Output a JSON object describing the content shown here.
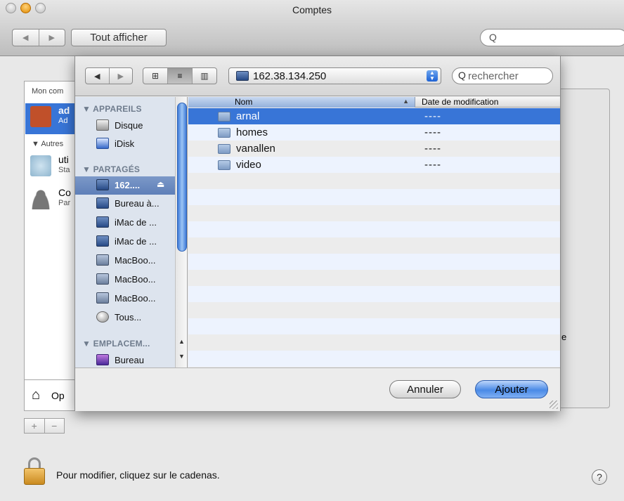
{
  "window": {
    "title": "Comptes",
    "show_all_label": "Tout afficher",
    "search_glyph": "Q"
  },
  "background": {
    "section_my_account": "Mon com",
    "user1_name": "ad",
    "user1_sub": "Ad",
    "section_others": "▼ Autres",
    "user2_name": "uti",
    "user2_sub": "Sta",
    "user3_name": "Co",
    "user3_sub": "Par",
    "options_label": "Op",
    "e_fragment": "e"
  },
  "footer": {
    "lock_text": "Pour modifier, cliquez sur le cadenas.",
    "help_label": "?"
  },
  "sheet": {
    "path_value": "162.38.134.250",
    "search_placeholder": "rechercher",
    "search_glyph": "Q",
    "sidebar": {
      "devices_header": "▼ APPAREILS",
      "devices": [
        {
          "label": "Disque",
          "icon": "disk-icon"
        },
        {
          "label": "iDisk",
          "icon": "idisk-icon"
        }
      ],
      "shared_header": "▼ PARTAGÉS",
      "shared": [
        {
          "label": "162....",
          "icon": "server-icon",
          "selected": true
        },
        {
          "label": "Bureau à...",
          "icon": "monitor-icon"
        },
        {
          "label": "iMac de ...",
          "icon": "monitor-icon"
        },
        {
          "label": "iMac de ...",
          "icon": "monitor-icon"
        },
        {
          "label": "MacBoo...",
          "icon": "laptop-icon"
        },
        {
          "label": "MacBoo...",
          "icon": "laptop-icon"
        },
        {
          "label": "MacBoo...",
          "icon": "laptop-icon"
        },
        {
          "label": "Tous...",
          "icon": "network-globe-icon"
        }
      ],
      "places_header": "▼ EMPLACEM...",
      "places": [
        {
          "label": "Bureau",
          "icon": "desktop-icon"
        }
      ]
    },
    "columns": {
      "name": "Nom",
      "modified": "Date de modification"
    },
    "files": [
      {
        "name": "arnal",
        "modified": "----",
        "selected": true
      },
      {
        "name": "homes",
        "modified": "----"
      },
      {
        "name": "vanallen",
        "modified": "----"
      },
      {
        "name": "video",
        "modified": "----"
      }
    ],
    "cancel_label": "Annuler",
    "add_label": "Ajouter"
  },
  "colors": {
    "selection": "#3875d7",
    "sidebar_bg": "#dde4ee",
    "default_button": "#4a8ae6"
  }
}
